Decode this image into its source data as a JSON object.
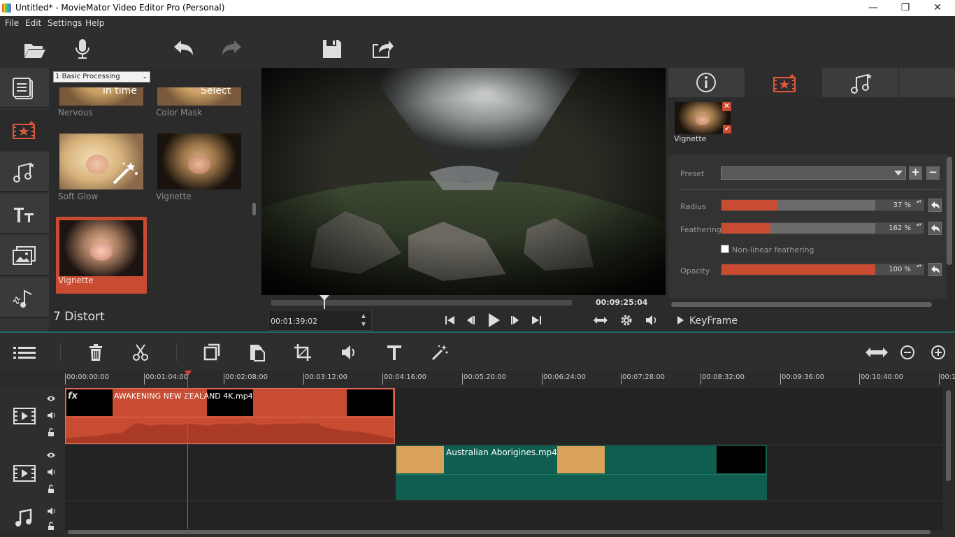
{
  "window": {
    "title": "Untitled* - MovieMator Video Editor Pro (Personal)",
    "controls": [
      "—",
      "❐",
      "✕"
    ]
  },
  "menu": [
    "File",
    "Edit",
    "Settings",
    "Help"
  ],
  "toolbar": {
    "buttons": [
      "open-folder-icon",
      "microphone-icon",
      "undo-icon",
      "redo-icon",
      "save-icon",
      "export-icon"
    ]
  },
  "leftnav": {
    "items": [
      "media-icon",
      "filters-icon",
      "audio-effects-icon",
      "text-icon",
      "image-icon",
      "audio-icon"
    ],
    "active": "filters-icon"
  },
  "effects": {
    "category": "1 Basic Processing",
    "items": [
      {
        "label": "Nervous",
        "overlay": "in time"
      },
      {
        "label": "Color Mask",
        "overlay": "Select"
      },
      {
        "label": "Soft Glow"
      },
      {
        "label": "Vignette"
      },
      {
        "label": "Vignette",
        "selected": true
      }
    ],
    "next_category": "7 Distort"
  },
  "player": {
    "duration": "00:09:25:04",
    "timecode": "00:01:39:02",
    "progress": 0.16
  },
  "properties": {
    "tabs": [
      "info-icon",
      "filter-icon",
      "audio-filter-icon"
    ],
    "active_tab": 1,
    "applied_filter": "Vignette",
    "preset_label": "Preset",
    "preset_value": "",
    "params": [
      {
        "label": "Radius",
        "value": "37 %",
        "fraction": 0.37
      },
      {
        "label": "Feathering",
        "value": "162 %",
        "fraction": 0.32
      },
      {
        "label": "Opacity",
        "value": "100 %",
        "fraction": 1.0
      }
    ],
    "nonlinear_label": "Non-linear feathering",
    "nonlinear_checked": false,
    "keyframe_label": "KeyFrame"
  },
  "timeline": {
    "tools": [
      "menu-icon",
      "delete-icon",
      "cut-icon",
      "copy-icon",
      "paste-icon",
      "crop-icon",
      "volume-icon",
      "text-icon",
      "magic-icon"
    ],
    "zoom_tools": [
      "fit-icon",
      "zoom-out-icon",
      "zoom-in-icon"
    ],
    "ruler": [
      "00:00:00:00",
      "00:01:04:00",
      "00:02:08:00",
      "00:03:12:00",
      "00:04:16:00",
      "00:05:20:00",
      "00:06:24:00",
      "00:07:28:00",
      "00:08:32:00",
      "00:09:36:00",
      "00:10:40:00",
      "00:1"
    ],
    "clips": [
      {
        "track": 1,
        "name": "AWAKENING   NEW ZEALAND 4K.mp4",
        "fx": "fx",
        "color": "#c84b32"
      },
      {
        "track": 2,
        "name": "Australian Aborigines.mp4",
        "color": "#0f5e4f"
      }
    ]
  }
}
